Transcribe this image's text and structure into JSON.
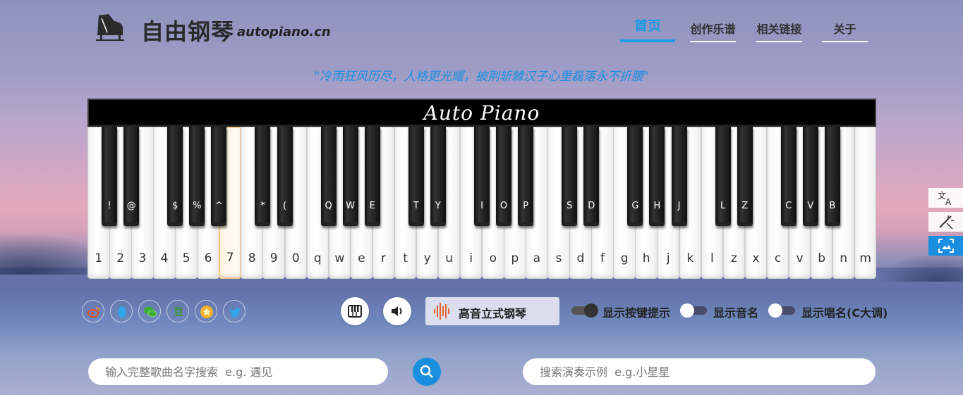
{
  "header": {
    "brand": "自由钢琴",
    "domain": "autopiano.cn",
    "logo_icon": "grand-piano-logo-icon",
    "nav": [
      {
        "label": "首页",
        "active": true
      },
      {
        "label": "创作乐谱",
        "active": false
      },
      {
        "label": "相关链接",
        "active": false
      },
      {
        "label": "关于",
        "active": false
      }
    ]
  },
  "quote": "\"冷雨狂风历尽，人格更光耀，披荆斩棘汉子心里磊落永不折腰\"",
  "piano": {
    "title": "Auto Piano",
    "white_keys": [
      "1",
      "2",
      "3",
      "4",
      "5",
      "6",
      "7",
      "8",
      "9",
      "0",
      "q",
      "w",
      "e",
      "r",
      "t",
      "y",
      "u",
      "i",
      "o",
      "p",
      "a",
      "s",
      "d",
      "f",
      "g",
      "h",
      "j",
      "k",
      "l",
      "z",
      "x",
      "c",
      "v",
      "b",
      "n",
      "m"
    ],
    "pressed_key": "7",
    "black_keys": [
      "!",
      "@",
      "$",
      "%",
      "^",
      "*",
      "(",
      "Q",
      "W",
      "E",
      "T",
      "Y",
      "I",
      "O",
      "P",
      "S",
      "D",
      "G",
      "H",
      "J",
      "L",
      "Z",
      "C",
      "V",
      "B"
    ]
  },
  "social": [
    "weibo-icon",
    "qq-icon",
    "wechat-icon",
    "douban-icon",
    "qzone-icon",
    "twitter-icon"
  ],
  "controls": {
    "keyboard_button_icon": "piano-keys-icon",
    "sound_button_icon": "speaker-icon",
    "instrument": "高音立式钢琴",
    "instrument_icon": "waveform-icon",
    "toggles": [
      {
        "label": "显示按键提示",
        "on": true
      },
      {
        "label": "显示音名",
        "on": false
      },
      {
        "label": "显示唱名(C大调)",
        "on": false
      }
    ]
  },
  "search": {
    "song_placeholder": "输入完整歌曲名字搜索  e.g. 遇见",
    "demo_placeholder": "搜索演奏示例  e.g.小星星",
    "button_icon": "search-icon"
  },
  "side_tools": [
    "translate-icon",
    "magic-wand-icon",
    "screenshot-icon"
  ],
  "colors": {
    "accent": "#1b9ae8"
  }
}
